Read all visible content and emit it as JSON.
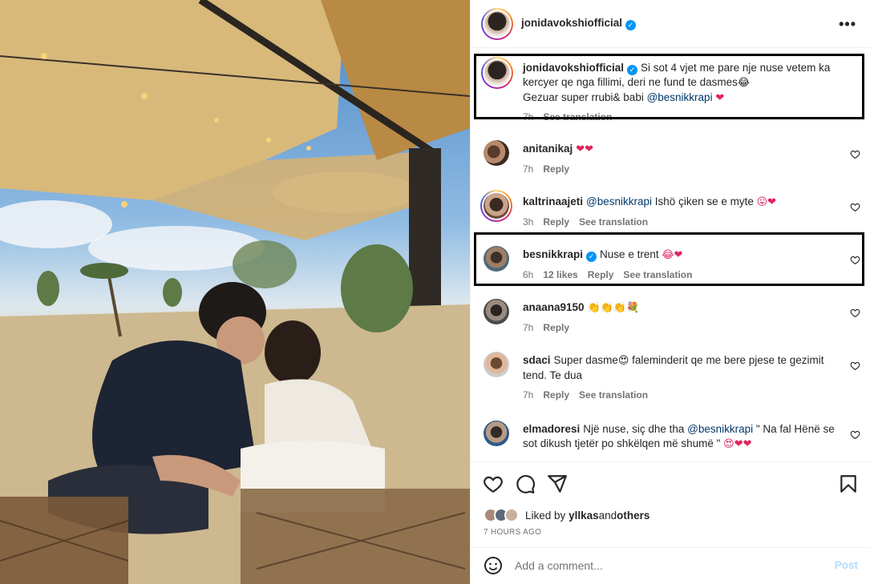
{
  "post": {
    "owner": "jonidavokshiofficial",
    "more_icon": "more-horizontal-icon"
  },
  "caption": {
    "user": "jonidavokshiofficial",
    "text_part1": "Si sot 4 vjet me pare nje nuse vetem ka kercyer qe nga fillimi, deri ne fund te dasmes",
    "emoji1": "😂",
    "text_part2": "Gezuar super rrubi& babi ",
    "mention": "@besnikkrapi",
    "emoji2": "❤",
    "time": "7h",
    "see_translation": "See translation"
  },
  "comments": [
    {
      "user": "anitanikaj",
      "text": "",
      "emoji": "❤❤",
      "time": "7h",
      "reply": "Reply"
    },
    {
      "user": "kaltrinaajeti",
      "mention": "@besnikkrapi",
      "text": " Ishö çiken se e myte ",
      "emoji": "😛❤",
      "time": "3h",
      "reply": "Reply",
      "see_translation": "See translation"
    },
    {
      "user": "besnikkrapi",
      "text": "Nuse e trent ",
      "emoji": "😂❤",
      "time": "6h",
      "likes": "12 likes",
      "reply": "Reply",
      "see_translation": "See translation"
    },
    {
      "user": "anaana9150",
      "text": "",
      "emoji": "👏👏👏💐",
      "time": "7h",
      "reply": "Reply"
    },
    {
      "user": "sdaci",
      "text": "Super dasme",
      "emoji": "😍",
      "text2": " faleminderit qe me bere pjese te gezimit tend. Te dua",
      "time": "7h",
      "reply": "Reply",
      "see_translation": "See translation"
    },
    {
      "user": "elmadoresi",
      "text": "Një nuse, siç dhe tha ",
      "mention": "@besnikkrapi",
      "text2": " \" Na fal Hënë se sot dikush tjetër po shkëlqen më shumë \" ",
      "emoji": "😍❤❤"
    }
  ],
  "liked_by": {
    "prefix": "Liked by ",
    "user": "yllkas",
    "and": " and ",
    "others": "others"
  },
  "time_ago": "7 HOURS AGO",
  "add_comment": {
    "placeholder": "Add a comment...",
    "post_label": "Post"
  },
  "colors": {
    "accent": "#0095f6",
    "mention": "#00376b",
    "muted": "#737373",
    "heart": "#e0245e"
  }
}
